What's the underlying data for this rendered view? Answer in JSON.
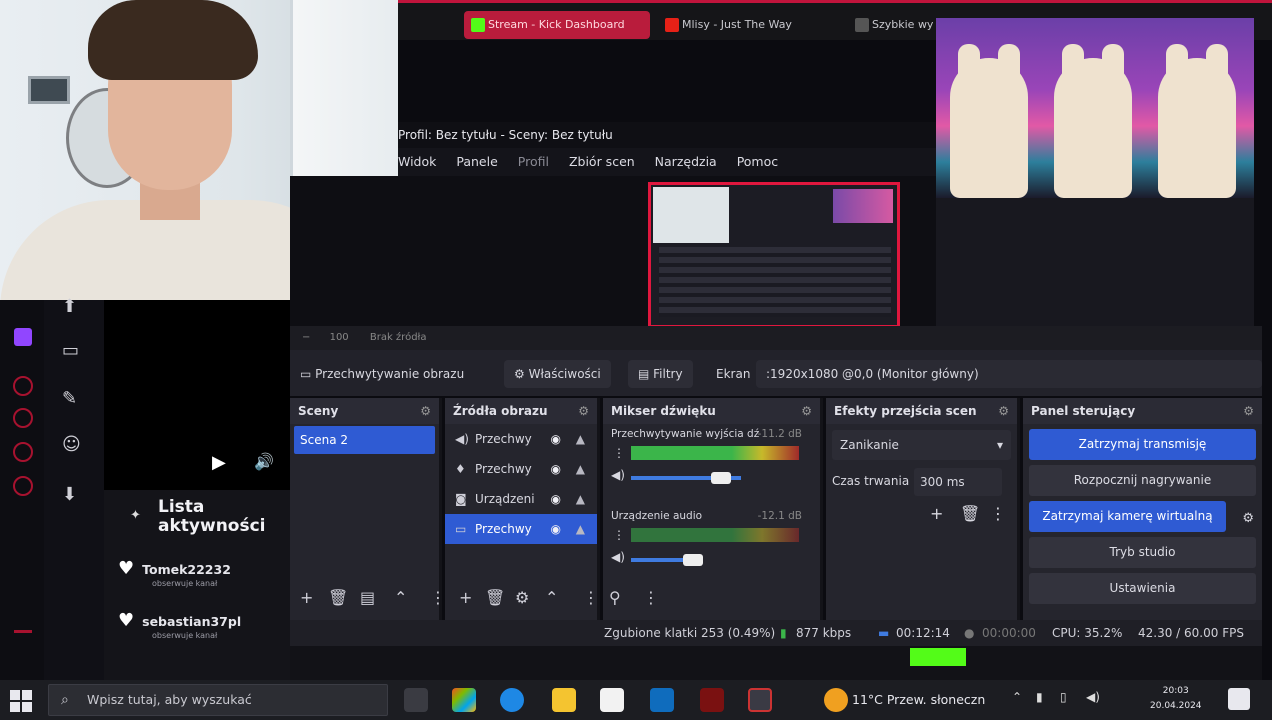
{
  "browser": {
    "tabs": [
      {
        "label": "Stream - Kick Dashboard",
        "active": true
      },
      {
        "label": "Mlisy - Just The Way",
        "active": false
      },
      {
        "label": "Szybkie wy",
        "active": false
      }
    ]
  },
  "obs": {
    "title": "Profil: Bez tytułu - Sceny: Bez tytułu",
    "menu": [
      "Widok",
      "Panele",
      "Profil",
      "Zbiór scen",
      "Narzędzia",
      "Pomoc"
    ],
    "toolbar_dim": [
      "100",
      "Brak źródła"
    ],
    "source_bar": {
      "source_name": "Przechwytywanie obrazu",
      "properties_label": "Właściwości",
      "filters_label": "Filtry",
      "display_label": "Ekran",
      "display_value": ":1920x1080 @0,0 (Monitor główny)"
    },
    "docks": {
      "scenes": {
        "title": "Sceny",
        "items": [
          "Scena 2"
        ]
      },
      "sources": {
        "title": "Źródła obrazu",
        "items": [
          {
            "label": "Przechwy",
            "icon": "speaker-icon",
            "selected": false
          },
          {
            "label": "Przechwy",
            "icon": "microphone-icon",
            "selected": false
          },
          {
            "label": "Urządzeni",
            "icon": "camera-icon",
            "selected": false
          },
          {
            "label": "Przechwy",
            "icon": "monitor-icon",
            "selected": true
          }
        ]
      },
      "mixer": {
        "title": "Mikser dźwięku",
        "tracks": [
          {
            "name": "Przechwytywanie wyjścia dź",
            "db": "-11.2 dB",
            "level": 0.8,
            "volume": 0.72
          },
          {
            "name": "Urządzenie audio",
            "db": "-12.1 dB",
            "level": 0.78,
            "volume": 0.48
          }
        ]
      },
      "transitions": {
        "title": "Efekty przejścia scen",
        "transition": "Zanikanie",
        "duration_label": "Czas trwania",
        "duration_value": "300 ms"
      },
      "controls": {
        "title": "Panel sterujący",
        "buttons": [
          {
            "label": "Zatrzymaj transmisję",
            "style": "blue"
          },
          {
            "label": "Rozpocznij nagrywanie",
            "style": "dark"
          },
          {
            "label": "Zatrzymaj kamerę wirtualną",
            "style": "blue"
          },
          {
            "label": "Tryb studio",
            "style": "dark"
          },
          {
            "label": "Ustawienia",
            "style": "dark"
          }
        ]
      }
    },
    "status": {
      "dropped": "Zgubione klatki 253 (0.49%)",
      "bitrate": "877 kbps",
      "live_time": "00:12:14",
      "rec_time": "00:00:00",
      "cpu": "CPU: 35.2%",
      "fps": "42.30 / 60.00 FPS"
    }
  },
  "activity": {
    "title_line1": "Lista",
    "title_line2": "aktywności",
    "items": [
      {
        "user": "Tomek22232",
        "sub": "obserwuje kanał"
      },
      {
        "user": "sebastian37pl",
        "sub": "obserwuje kanał"
      }
    ]
  },
  "taskbar": {
    "search_placeholder": "Wpisz tutaj, aby wyszukać",
    "weather": "11°C  Przew. słoneczn",
    "time": "20:03",
    "date": "20.04.2024"
  },
  "colors": {
    "accent": "#2f5bd3",
    "brand": "#b91c3c",
    "dock_bg": "#25252d"
  }
}
